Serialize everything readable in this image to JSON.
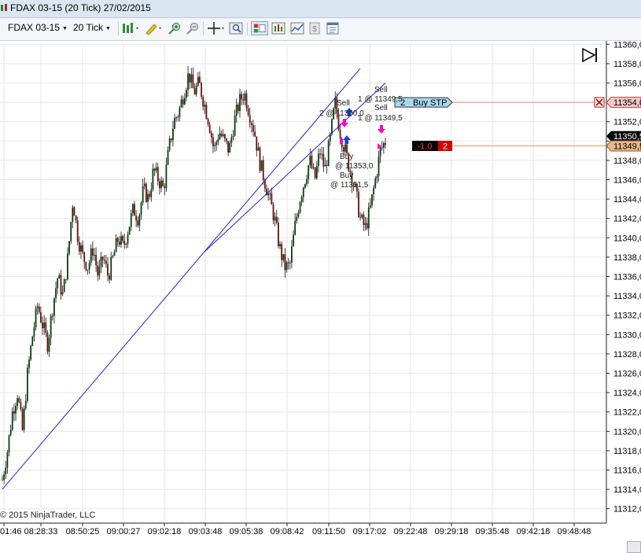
{
  "window": {
    "title": "FDAX 03-15 (20 Tick)  27/02/2015"
  },
  "toolbar": {
    "instrument": "FDAX 03-15",
    "interval": "20 Tick",
    "icons": [
      "bar-style-icon",
      "drawing-tool-icon",
      "zoom-in-icon",
      "zoom-out-icon",
      "crosshair-icon",
      "magnifier-icon",
      "chart-trader-icon",
      "data-series-icon",
      "indicators-icon",
      "strategies-icon",
      "properties-icon"
    ]
  },
  "price_axis": {
    "labels": [
      "11360,0",
      "11358,0",
      "11356,0",
      "11354,0",
      "11352,0",
      "11350,0",
      "11348,0",
      "11346,0",
      "11344,0",
      "11342,0",
      "11340,0",
      "11338,0",
      "11336,0",
      "11334,0",
      "11332,0",
      "11330,0",
      "11328,0",
      "11326,0",
      "11324,0",
      "11322,0",
      "11320,0",
      "11318,0",
      "11316,0",
      "11314,0",
      "11312,0"
    ],
    "current_price_label": "11350,5",
    "position_price_label": "11349,5",
    "stop_price_label": "11354,0"
  },
  "time_axis": {
    "labels": [
      "01:46",
      "08:28:33",
      "08:50:25",
      "09:00:27",
      "09:02:18",
      "09:03:48",
      "09:05:38",
      "09:08:42",
      "09:11:50",
      "09:17:02",
      "09:22:48",
      "09:29:18",
      "09:35:48",
      "09:42:18",
      "09:48:48"
    ]
  },
  "copyright": "© 2015 NinjaTrader, LLC",
  "orders": {
    "stop_order": {
      "quantity": "2",
      "label": "Buy STP",
      "price": 11354.0
    },
    "position": {
      "pnl": "-1.0",
      "quantity": "2",
      "price": 11349.5
    }
  },
  "executions": [
    {
      "text": [
        "Sell",
        "1 @ 11349,5"
      ]
    },
    {
      "text": [
        "Sell",
        "2 @ 11350,0"
      ]
    },
    {
      "text": [
        "Sell",
        "1 @ 11349,5"
      ]
    },
    {
      "text": [
        "Buy",
        "@ 11353,0"
      ]
    },
    {
      "text": [
        "Buy",
        "@ 11351,5"
      ]
    }
  ],
  "colors": {
    "bull_candle": "#0b3d0b",
    "bear_candle": "#6b0f0f",
    "trendline": "#2222cc",
    "grid": "#e6e6e6",
    "stop_line": "#ef9a9a",
    "position_line": "#d8a070",
    "order_label_bg": "#a8d8ee",
    "position_label_bg": "#e8b98a",
    "sell_marker": "#ff00cc",
    "buy_marker": "#1c3fe0"
  },
  "chart_data": {
    "type": "candlestick",
    "ylim": [
      11312,
      11361
    ],
    "x_tick_labels": [
      "01:46",
      "08:28:33",
      "08:50:25",
      "09:00:27",
      "09:02:18",
      "09:03:48",
      "09:05:38",
      "09:08:42",
      "09:11:50",
      "09:17:02",
      "09:22:48",
      "09:29:18",
      "09:35:48",
      "09:42:18",
      "09:48:48"
    ],
    "close_path": [
      11315,
      11318,
      11322,
      11324,
      11320,
      11326,
      11330,
      11333,
      11331,
      11329,
      11333,
      11336,
      11334,
      11338,
      11344,
      11340,
      11338,
      11337,
      11339,
      11336,
      11338,
      11336,
      11338,
      11340,
      11339,
      11341,
      11343,
      11342,
      11345,
      11344,
      11347,
      11346,
      11345,
      11349,
      11352,
      11353,
      11355,
      11357,
      11355,
      11356,
      11354,
      11352,
      11349,
      11351,
      11350,
      11349,
      11352,
      11354,
      11355,
      11353,
      11351,
      11348,
      11346,
      11344,
      11342,
      11339,
      11337,
      11337,
      11341,
      11344,
      11346,
      11348,
      11346,
      11349,
      11347,
      11350,
      11354,
      11351,
      11349,
      11347,
      11345,
      11342,
      11341,
      11343,
      11346,
      11349,
      11350
    ],
    "trendlines": [
      {
        "from": {
          "time_index": 0,
          "price": 11314.0
        },
        "to": {
          "time_index": 71,
          "price": 11357.5
        }
      },
      {
        "from": {
          "time_index": 40,
          "price": 11338.5
        },
        "to": {
          "time_index": 76,
          "price": 11356.0
        }
      }
    ]
  }
}
